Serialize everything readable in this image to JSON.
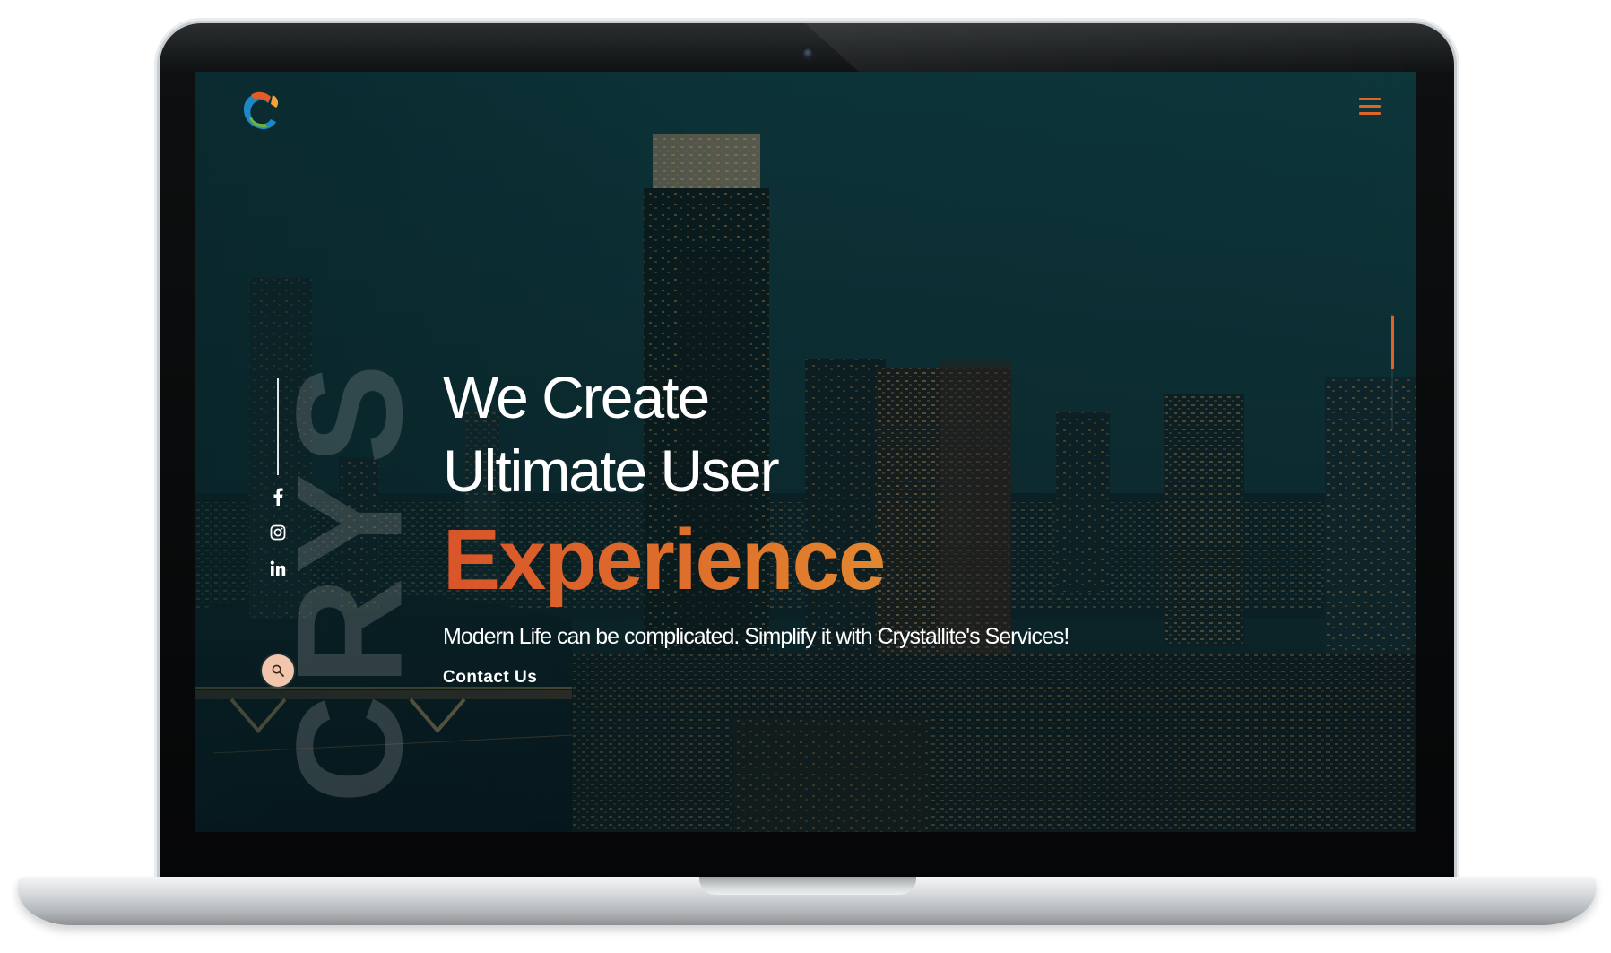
{
  "brand": {
    "logo_icon": "crystallite-c-logo-icon",
    "vertical_text": "CRYS"
  },
  "header": {
    "menu_icon": "hamburger-menu-icon"
  },
  "hero": {
    "line1": "We Create",
    "line2": "Ultimate User",
    "accent": "Experience",
    "subtitle": "Modern Life can be complicated. Simplify it with Crystallite's Services!",
    "cta_label": "Contact Us"
  },
  "social": {
    "icons": [
      "facebook-icon",
      "instagram-icon",
      "linkedin-icon"
    ]
  },
  "search": {
    "icon": "search-icon"
  },
  "colors": {
    "accent": "#e0642a",
    "accent_gradient_end": "#e6a03a",
    "background": "#0f3438",
    "search_button": "#f1c6ad"
  }
}
